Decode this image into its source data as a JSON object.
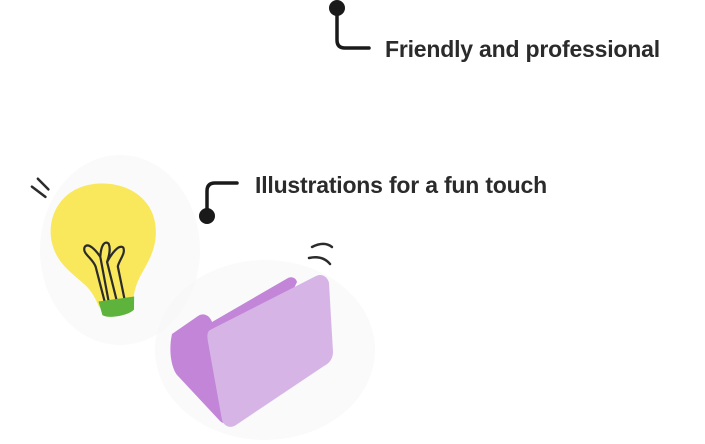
{
  "callouts": [
    {
      "text": "Friendly and professional"
    },
    {
      "text": "Illustrations for a fun touch"
    }
  ],
  "illustrations": [
    {
      "icon": "lightbulb-icon",
      "color": "#F9E75C",
      "base_color": "#5DB33B"
    },
    {
      "icon": "folder-icon",
      "color": "#D6B5E6",
      "back_color": "#C385D8"
    }
  ],
  "colors": {
    "text": "#2b2b2b",
    "connector": "#1a1a1a",
    "background": "#ffffff"
  }
}
